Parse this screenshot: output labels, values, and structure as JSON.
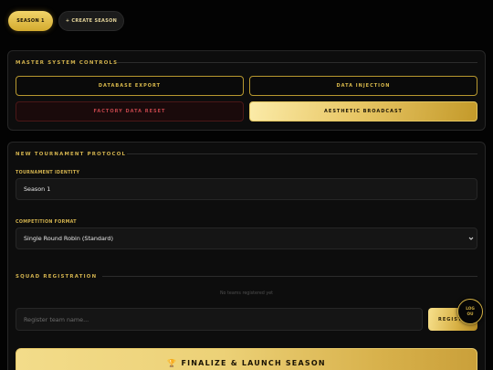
{
  "season_tabs": {
    "active_label": "SEASON 1",
    "create_label": "+ CREATE SEASON"
  },
  "master_controls": {
    "title": "MASTER SYSTEM CONTROLS",
    "export_label": "DATABASE EXPORT",
    "injection_label": "DATA INJECTION",
    "reset_label": "FACTORY DATA RESET",
    "broadcast_label": "AESTHETIC BROADCAST"
  },
  "tournament": {
    "title": "NEW TOURNAMENT PROTOCOL",
    "identity_label": "TOURNAMENT IDENTITY",
    "identity_value": "Season 1",
    "format_label": "COMPETITION FORMAT",
    "format_value": "Single Round Robin (Standard)"
  },
  "squad": {
    "title": "SQUAD REGISTRATION",
    "empty_note": "No teams registered yet",
    "team_placeholder": "Register team name...",
    "register_label": "REGIST",
    "log_line1": "LOG",
    "log_line2": "OU"
  },
  "launch": {
    "icon": "trophy-icon",
    "label": "FINALIZE & LAUNCH SEASON"
  },
  "colors": {
    "gold": "#d2b24e",
    "background": "#030303",
    "danger": "#c0444a"
  }
}
